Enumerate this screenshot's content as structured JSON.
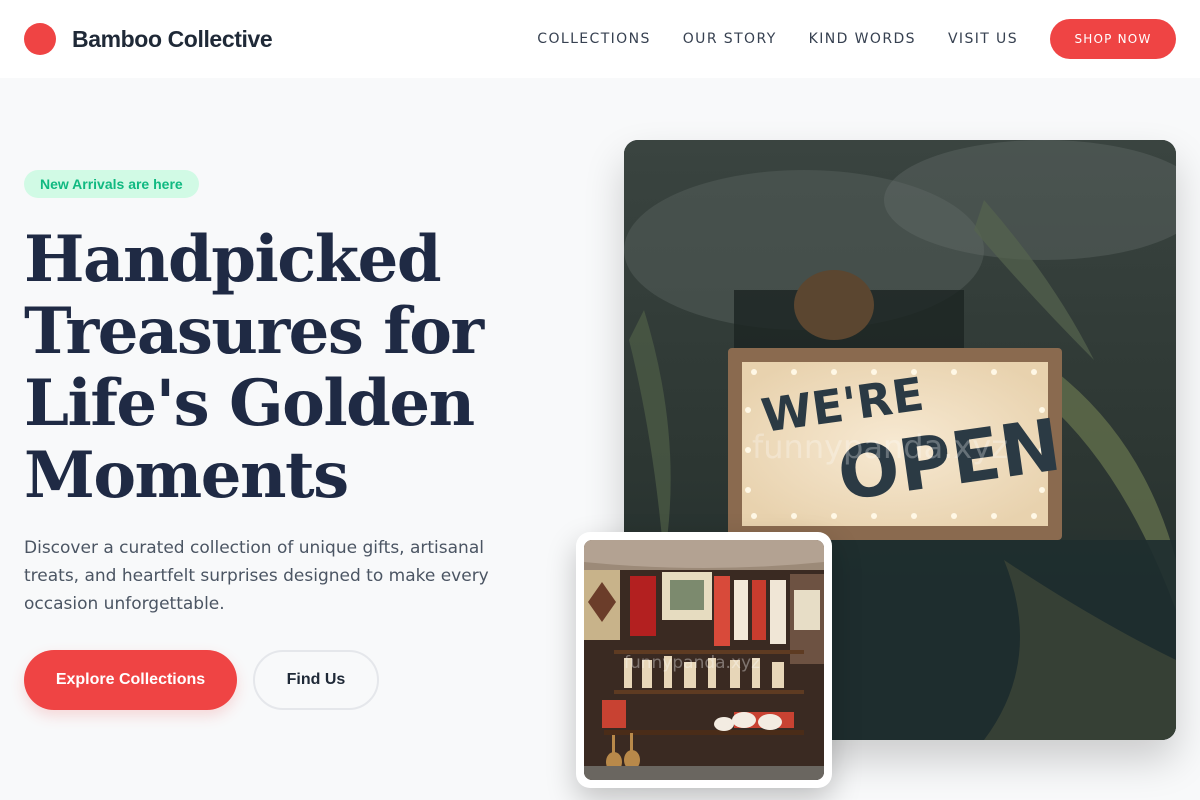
{
  "header": {
    "brand": "Bamboo Collective",
    "nav": [
      "COLLECTIONS",
      "OUR STORY",
      "KIND WORDS",
      "VISIT US"
    ],
    "cta": "SHOP NOW"
  },
  "hero": {
    "badge": "New Arrivals are here",
    "title": "Handpicked Treasures for Life's Golden Moments",
    "description": "Discover a curated collection of unique gifts, artisanal treats, and heartfelt surprises designed to make every occasion unforgettable.",
    "primary_button": "Explore Collections",
    "secondary_button": "Find Us"
  },
  "images": {
    "main": {
      "sign_line1": "WE'RE",
      "sign_line2": "OPEN",
      "watermark": "funnypanda.xyz"
    },
    "inset": {
      "watermark": "funnypanda.xyz"
    }
  },
  "colors": {
    "accent": "#ef4444",
    "badge_bg": "#d1fae5",
    "badge_text": "#10b981",
    "heading": "#1f2a44"
  }
}
